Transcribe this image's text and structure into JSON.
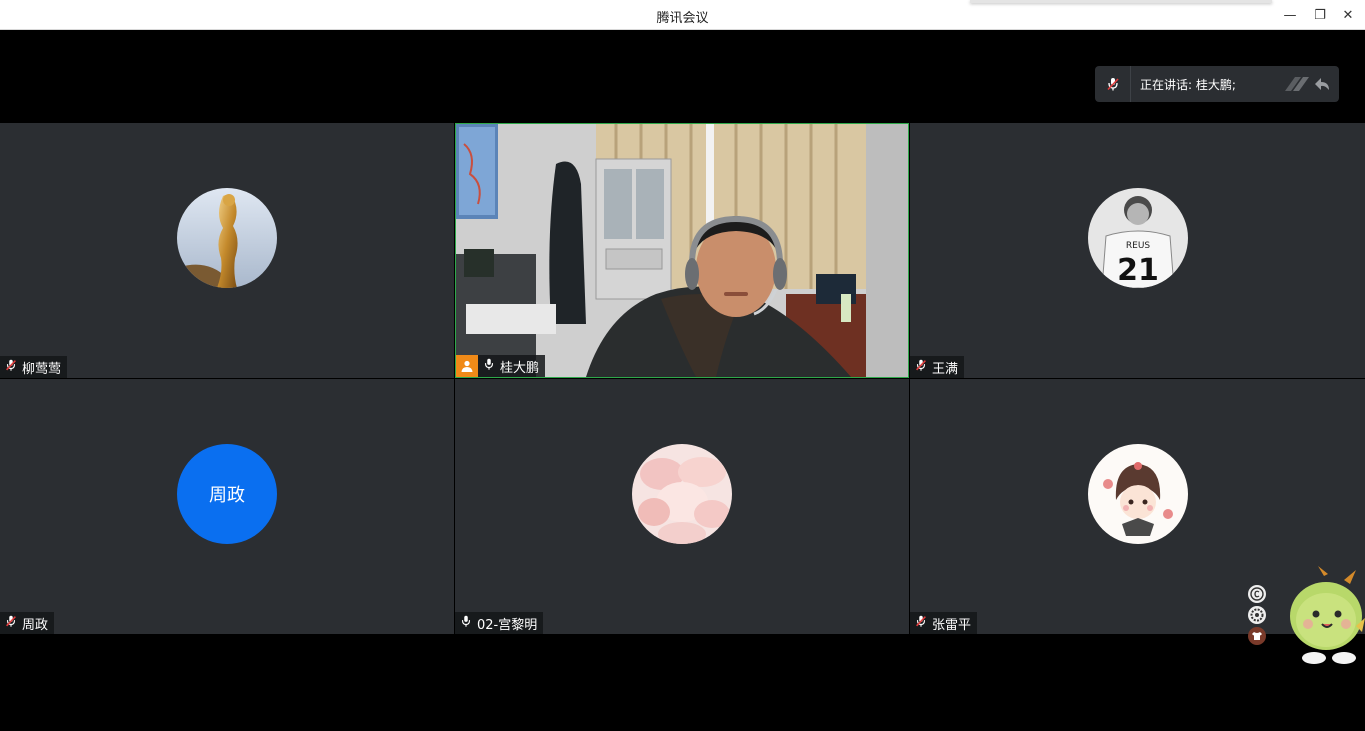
{
  "window": {
    "title": "腾讯会议",
    "minimize": "—",
    "restore": "❐",
    "close": "✕"
  },
  "speaking": {
    "text": "正在讲话: 桂大鹏;"
  },
  "participants": [
    {
      "name": "柳莺莺",
      "mic": "muted"
    },
    {
      "name": "桂大鹏",
      "mic": "on"
    },
    {
      "name": "王满",
      "mic": "muted"
    },
    {
      "name": "周政",
      "mic": "muted",
      "avatar_text": "周政"
    },
    {
      "name": "02-宫黎明",
      "mic": "on"
    },
    {
      "name": "张雷平",
      "mic": "muted"
    }
  ],
  "colors": {
    "tile_bg": "#2b2e32",
    "active_border": "#2ea84a",
    "avatar_blue": "#0a6ff0",
    "host_badge": "#f08a18"
  },
  "icons": [
    "mic-muted-icon",
    "mic-icon",
    "host-icon",
    "minimize-icon",
    "restore-icon",
    "close-icon"
  ]
}
